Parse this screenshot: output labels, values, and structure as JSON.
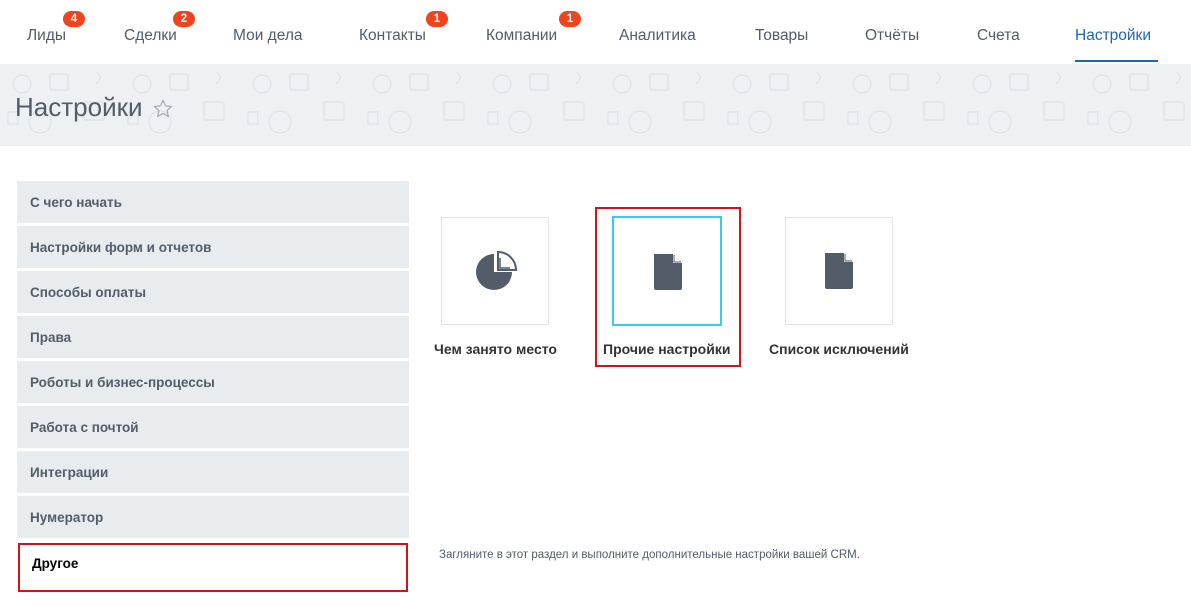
{
  "nav": {
    "items": [
      {
        "label": "Лиды",
        "badge": "4"
      },
      {
        "label": "Сделки",
        "badge": "2"
      },
      {
        "label": "Мои дела",
        "badge": ""
      },
      {
        "label": "Контакты",
        "badge": "1"
      },
      {
        "label": "Компании",
        "badge": "1"
      },
      {
        "label": "Аналитика",
        "badge": ""
      },
      {
        "label": "Товары",
        "badge": ""
      },
      {
        "label": "Отчёты",
        "badge": ""
      },
      {
        "label": "Счета",
        "badge": ""
      },
      {
        "label": "Настройки",
        "badge": "",
        "active": true
      }
    ]
  },
  "page": {
    "title": "Настройки",
    "star_icon": "star-outline-icon"
  },
  "sidebar": {
    "items": [
      {
        "label": "С чего начать"
      },
      {
        "label": "Настройки форм и отчетов"
      },
      {
        "label": "Способы оплаты"
      },
      {
        "label": "Права"
      },
      {
        "label": "Роботы и бизнес-процессы"
      },
      {
        "label": "Работа с почтой"
      },
      {
        "label": "Интеграции"
      },
      {
        "label": "Нумератор"
      },
      {
        "label": "Другое",
        "selected": true
      }
    ]
  },
  "tiles": [
    {
      "label": "Чем занято место",
      "icon": "pie-chart-icon"
    },
    {
      "label": "Прочие настройки",
      "icon": "document-icon",
      "active": true
    },
    {
      "label": "Список исключений",
      "icon": "document-icon"
    }
  ],
  "description": "Загляните в этот раздел и выполните дополнительные настройки вашей CRM.",
  "colors": {
    "accent": "#2067b0",
    "badge": "#f0441f",
    "highlight": "#d1141b",
    "tile_active": "#3bc8f5",
    "icon": "#535c69"
  }
}
